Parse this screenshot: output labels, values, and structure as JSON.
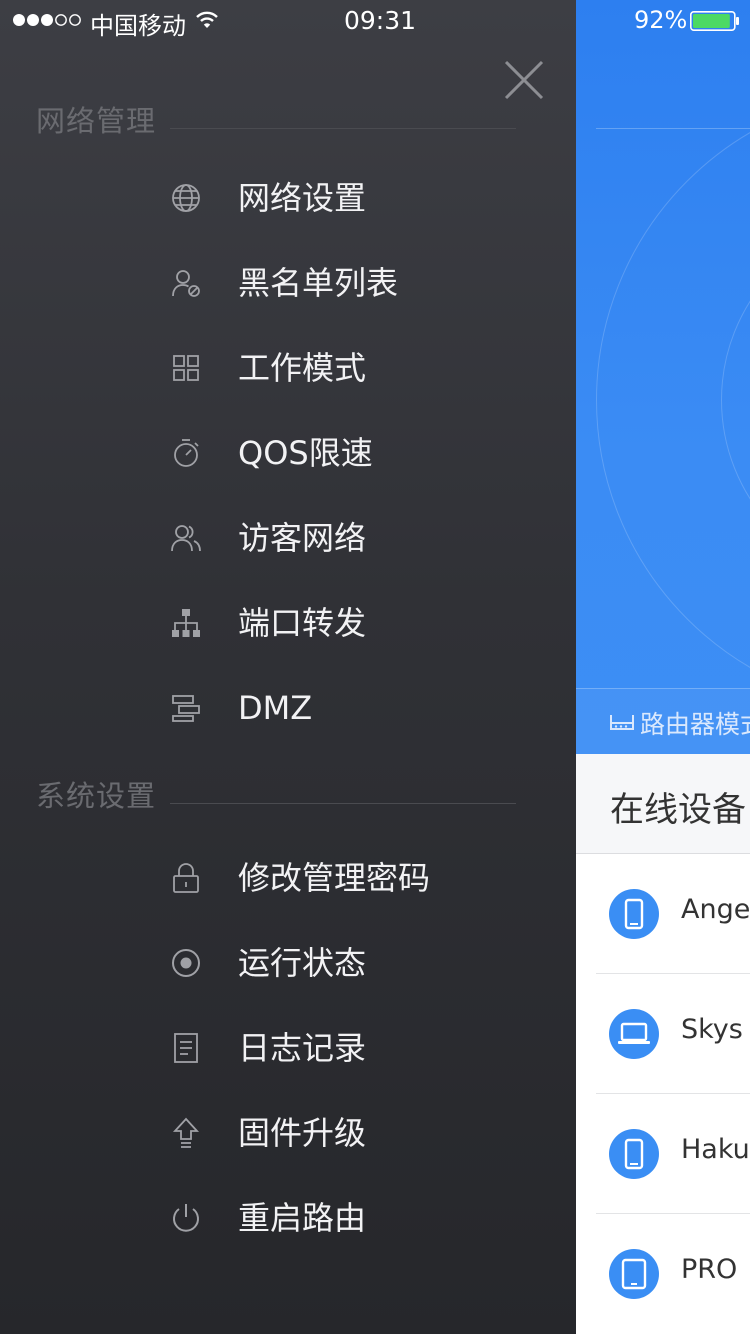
{
  "status_bar": {
    "carrier": "中国移动",
    "time": "09:31",
    "battery": "92%",
    "battery_level": 0.92
  },
  "drawer": {
    "close_icon": "close-icon",
    "sections": [
      {
        "title": "网络管理",
        "items": [
          {
            "label": "网络设置",
            "icon": "globe-icon"
          },
          {
            "label": "黑名单列表",
            "icon": "blocked-user-icon"
          },
          {
            "label": "工作模式",
            "icon": "grid-icon"
          },
          {
            "label": "QOS限速",
            "icon": "stopwatch-icon"
          },
          {
            "label": "访客网络",
            "icon": "guests-icon"
          },
          {
            "label": "端口转发",
            "icon": "network-tree-icon"
          },
          {
            "label": "DMZ",
            "icon": "dmz-icon"
          }
        ]
      },
      {
        "title": "系统设置",
        "items": [
          {
            "label": "修改管理密码",
            "icon": "lock-icon"
          },
          {
            "label": "运行状态",
            "icon": "status-dot-icon"
          },
          {
            "label": "日志记录",
            "icon": "document-icon"
          },
          {
            "label": "固件升级",
            "icon": "upgrade-arrow-icon"
          },
          {
            "label": "重启路由",
            "icon": "power-icon"
          }
        ]
      }
    ]
  },
  "main": {
    "mode_label": "路由器模式",
    "online_title": "在线设备",
    "devices": [
      {
        "name": "Ange",
        "icon": "phone-icon"
      },
      {
        "name": "Skys",
        "icon": "laptop-icon"
      },
      {
        "name": "Hakur",
        "icon": "phone-icon"
      },
      {
        "name": "PRO",
        "icon": "tablet-icon"
      }
    ]
  },
  "colors": {
    "drawer_bg": "#303136",
    "accent_blue": "#3a8ef4",
    "menu_text": "#f2f2f4",
    "section_text": "#6a6b70"
  }
}
